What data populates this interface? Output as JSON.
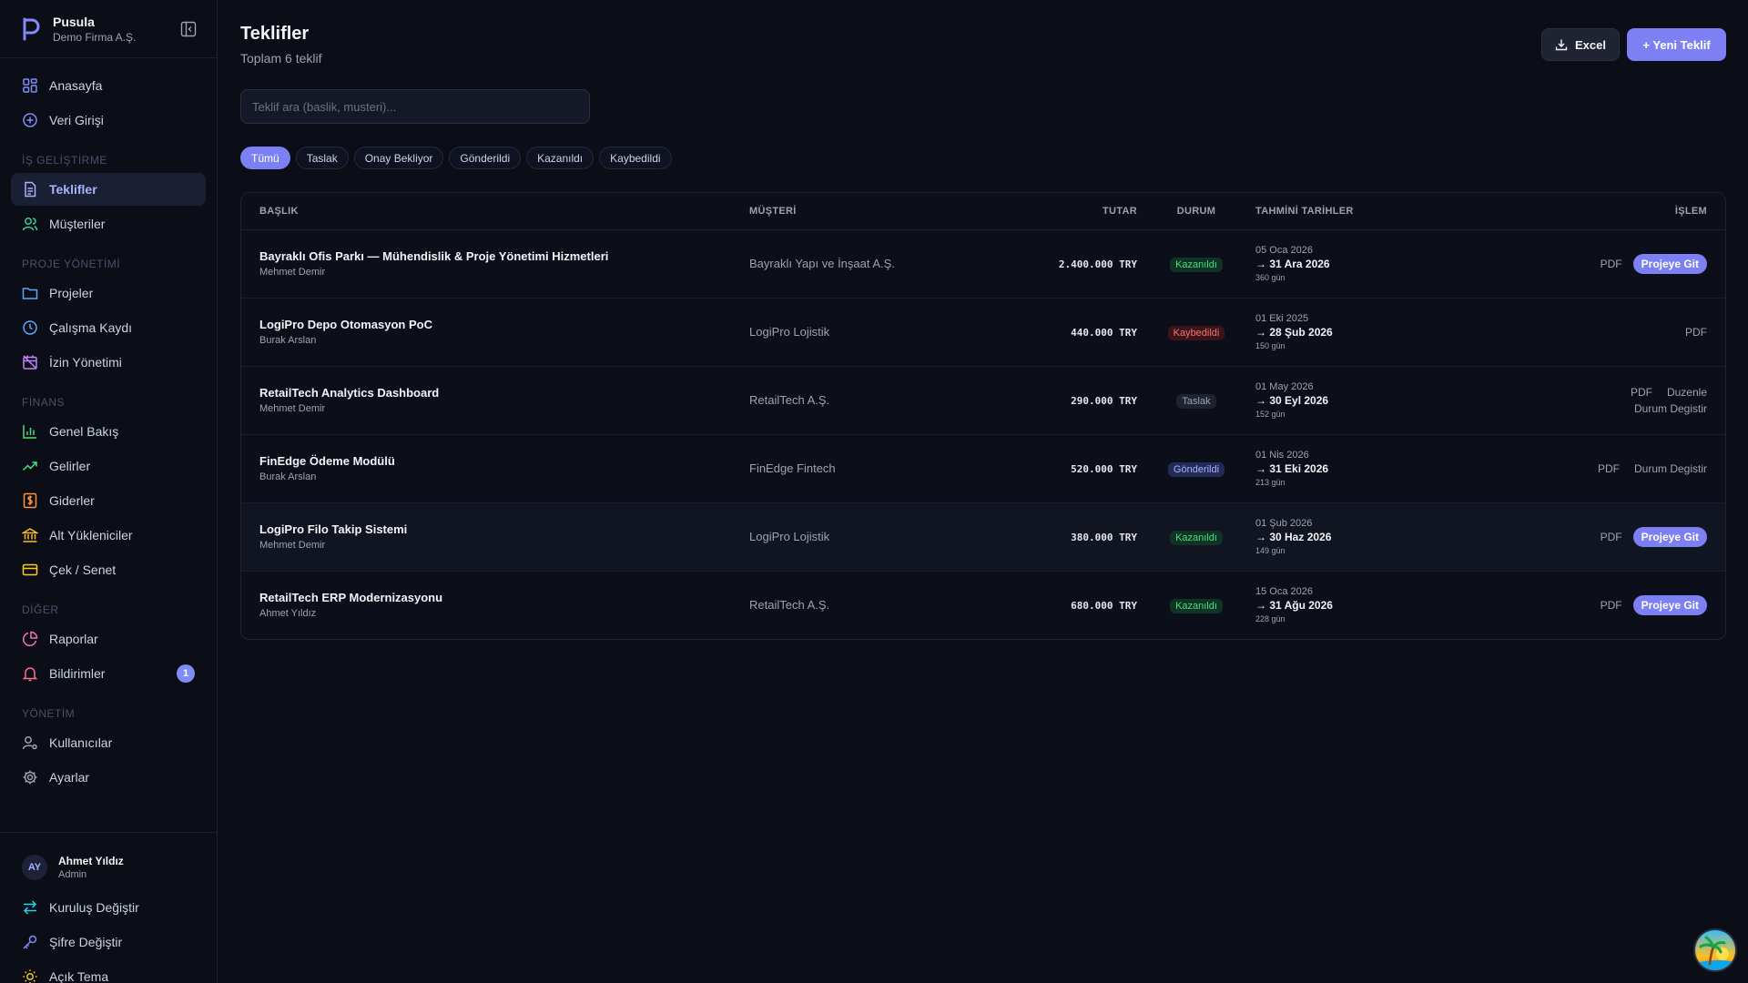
{
  "brand": {
    "name": "Pusula",
    "company": "Demo Firma A.Ş."
  },
  "nav": {
    "home": "Anasayfa",
    "data_entry": "Veri Girişi",
    "section_bd": "İŞ GELİŞTİRME",
    "offers": "Teklifler",
    "customers": "Müşteriler",
    "section_pm": "PROJE YÖNETİMİ",
    "projects": "Projeler",
    "worklog": "Çalışma Kaydı",
    "leave": "İzin Yönetimi",
    "section_fin": "FİNANS",
    "overview": "Genel Bakış",
    "income": "Gelirler",
    "expenses": "Giderler",
    "subcontractors": "Alt Yükleniciler",
    "cheques": "Çek / Senet",
    "section_other": "DİĞER",
    "reports": "Raporlar",
    "notifications": "Bildirimler",
    "notifications_count": "1",
    "section_admin": "YÖNETİM",
    "users": "Kullanıcılar",
    "settings": "Ayarlar"
  },
  "user": {
    "initials": "AY",
    "name": "Ahmet Yıldız",
    "role": "Admin"
  },
  "footer": {
    "switch_org": "Kuruluş Değiştir",
    "change_password": "Şifre Değiştir",
    "light_theme": "Açık Tema"
  },
  "page": {
    "title": "Teklifler",
    "subtitle": "Toplam 6 teklif"
  },
  "actions": {
    "excel": "Excel",
    "new_offer": "+ Yeni Teklif"
  },
  "search": {
    "placeholder": "Teklif ara (baslik, musteri)..."
  },
  "filters": [
    "Tümü",
    "Taslak",
    "Onay Bekliyor",
    "Gönderildi",
    "Kazanıldı",
    "Kaybedildi"
  ],
  "table": {
    "headers": {
      "title": "BAŞLIK",
      "customer": "MÜŞTERİ",
      "amount": "TUTAR",
      "status": "DURUM",
      "dates": "TAHMİNİ TARİHLER",
      "action": "İŞLEM"
    },
    "rows": [
      {
        "title": "Bayraklı Ofis Parkı — Mühendislik & Proje Yönetimi Hizmetleri",
        "owner": "Mehmet Demir",
        "customer": "Bayraklı Yapı ve İnşaat A.Ş.",
        "amount": "2.400.000 TRY",
        "status": "Kazanıldı",
        "start": "05 Oca 2026",
        "end": "→ 31 Ara 2026",
        "days": "360 gün",
        "pdf": "PDF",
        "goto": "Projeye Git"
      },
      {
        "title": "LogiPro Depo Otomasyon PoC",
        "owner": "Burak Arslan",
        "customer": "LogiPro Lojistik",
        "amount": "440.000 TRY",
        "status": "Kaybedildi",
        "start": "01 Eki 2025",
        "end": "→ 28 Şub 2026",
        "days": "150 gün",
        "pdf": "PDF"
      },
      {
        "title": "RetailTech Analytics Dashboard",
        "owner": "Mehmet Demir",
        "customer": "RetailTech A.Ş.",
        "amount": "290.000 TRY",
        "status": "Taslak",
        "start": "01 May 2026",
        "end": "→ 30 Eyl 2026",
        "days": "152 gün",
        "pdf": "PDF",
        "edit": "Duzenle",
        "change_status": "Durum Degistir"
      },
      {
        "title": "FinEdge Ödeme Modülü",
        "owner": "Burak Arslan",
        "customer": "FinEdge Fintech",
        "amount": "520.000 TRY",
        "status": "Gönderildi",
        "start": "01 Nis 2026",
        "end": "→ 31 Eki 2026",
        "days": "213 gün",
        "pdf": "PDF",
        "change_status": "Durum Degistir"
      },
      {
        "title": "LogiPro Filo Takip Sistemi",
        "owner": "Mehmet Demir",
        "customer": "LogiPro Lojistik",
        "amount": "380.000 TRY",
        "status": "Kazanıldı",
        "start": "01 Şub 2026",
        "end": "→ 30 Haz 2026",
        "days": "149 gün",
        "pdf": "PDF",
        "goto": "Projeye Git"
      },
      {
        "title": "RetailTech ERP Modernizasyonu",
        "owner": "Ahmet Yıldız",
        "customer": "RetailTech A.Ş.",
        "amount": "680.000 TRY",
        "status": "Kazanıldı",
        "start": "15 Oca 2026",
        "end": "→ 31 Ağu 2026",
        "days": "228 gün",
        "pdf": "PDF",
        "goto": "Projeye Git"
      }
    ]
  },
  "colors": {
    "accent": "#7c80f2",
    "background": "#0b0d17",
    "won": "#4ade80",
    "lost": "#f87171",
    "sent": "#a5b4fc"
  }
}
